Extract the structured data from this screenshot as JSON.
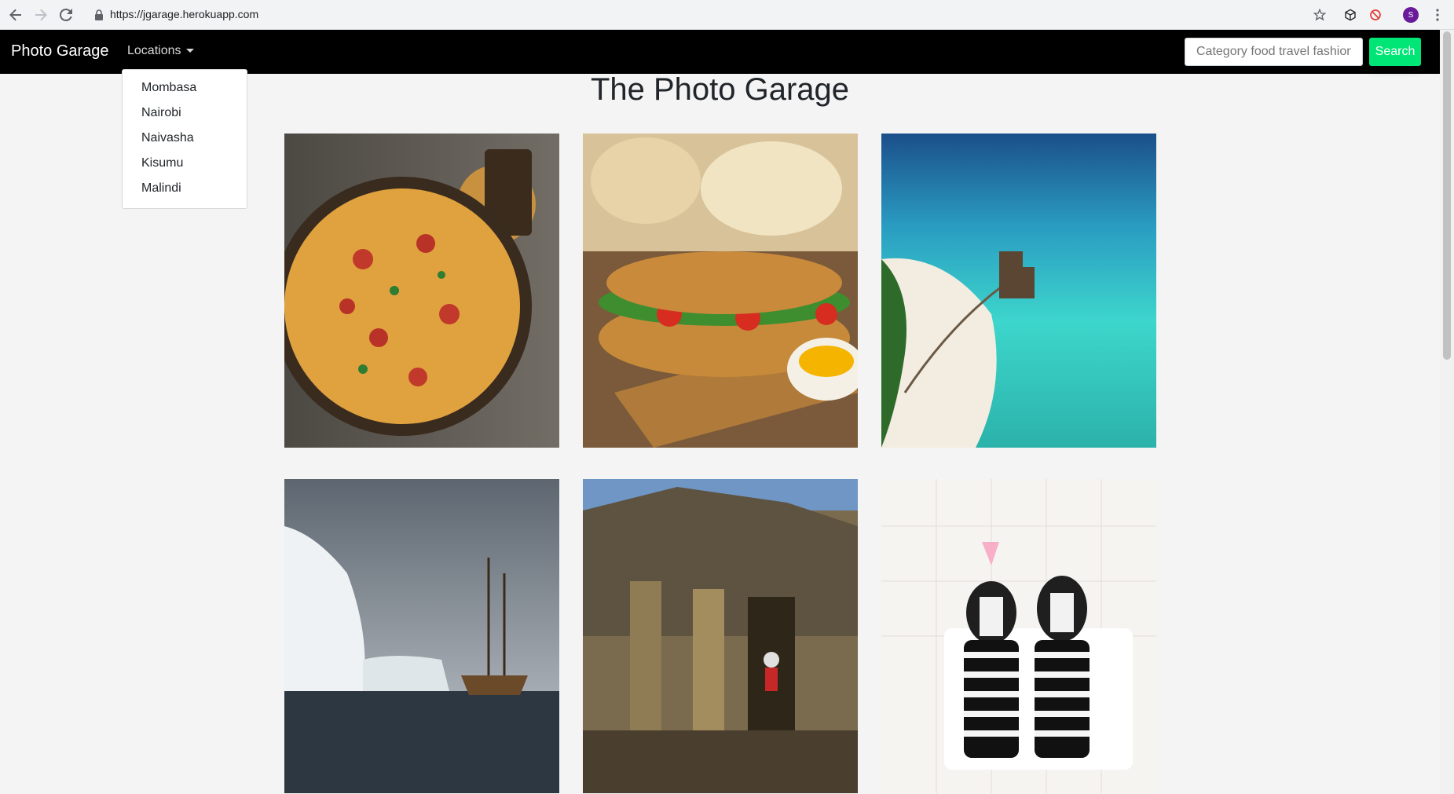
{
  "browser": {
    "url": "https://jgarage.herokuapp.com",
    "profile_initial": "S"
  },
  "navbar": {
    "brand": "Photo Garage",
    "locations_label": "Locations",
    "search_placeholder": "Category food travel fashion",
    "search_button": "Search"
  },
  "dropdown": {
    "items": [
      "Mombasa",
      "Nairobi",
      "Naivasha",
      "Kisumu",
      "Malindi"
    ]
  },
  "main": {
    "title": "The Photo Garage",
    "images": [
      {
        "subject": "pizza"
      },
      {
        "subject": "sandwich"
      },
      {
        "subject": "island-resort"
      },
      {
        "subject": "iceberg-ship"
      },
      {
        "subject": "temple-ruins"
      },
      {
        "subject": "dogs-in-striped-shirts"
      }
    ]
  },
  "colors": {
    "navbar_bg": "#000000",
    "search_button": "#00e676",
    "page_bg": "#f4f4f4"
  }
}
